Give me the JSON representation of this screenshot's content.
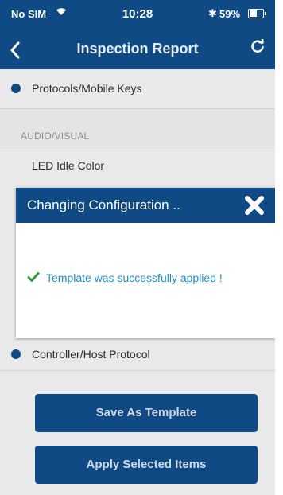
{
  "status_bar": {
    "carrier": "No SIM",
    "time": "10:28",
    "battery_percent": "59%",
    "battery_level": 0.59
  },
  "nav": {
    "back_icon": "chevron-left-icon",
    "title": "Inspection Report",
    "refresh_icon": "refresh-icon"
  },
  "list": {
    "item_protocols": "Protocols/Mobile Keys",
    "section_audio_visual": "AUDIO/VISUAL",
    "item_led": "LED Idle Color",
    "item_controller": "Controller/Host Protocol"
  },
  "dialog": {
    "title": "Changing Configuration ..",
    "message": "Template was successfully applied !",
    "close_icon": "close-icon",
    "check_icon": "checkmark-icon"
  },
  "buttons": {
    "save_template": "Save As Template",
    "apply_selected": "Apply Selected Items"
  },
  "colors": {
    "primary": "#0f4a85",
    "background": "#e9e9e9",
    "success": "#2e9e3a",
    "message": "#1f8fc8"
  }
}
